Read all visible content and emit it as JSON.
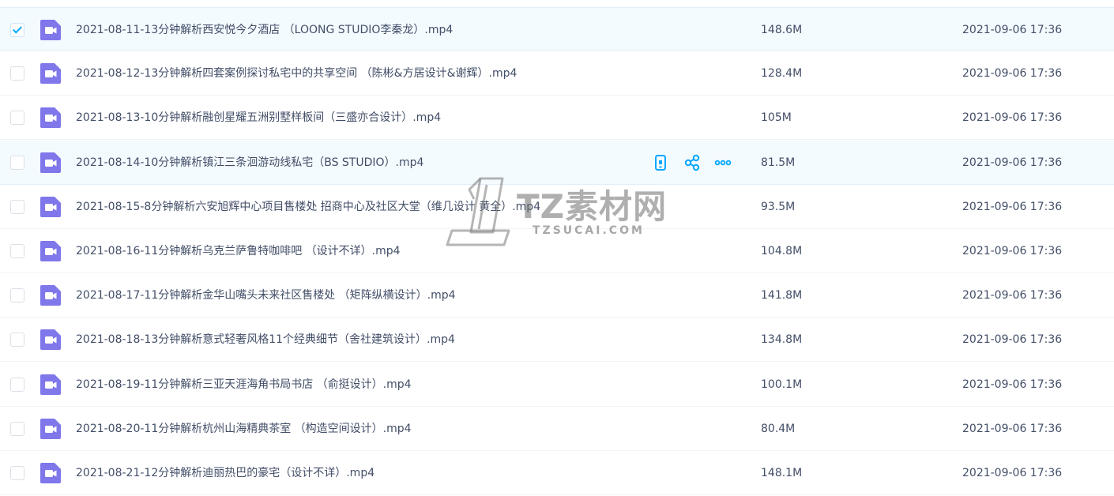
{
  "files": [
    {
      "name": "2021-08-11-13分钟解析西安悦今夕酒店 （LOONG STUDIO李秦龙）.mp4",
      "size": "148.6M",
      "date": "2021-09-06 17:36",
      "checked": true,
      "highlighted": true
    },
    {
      "name": "2021-08-12-13分钟解析四套案例探讨私宅中的共享空间 （陈彬&方居设计&谢辉）.mp4",
      "size": "128.4M",
      "date": "2021-09-06 17:36",
      "checked": false,
      "highlighted": false
    },
    {
      "name": "2021-08-13-10分钟解析融创星耀五洲别墅样板间（三盛亦合设计）.mp4",
      "size": "105M",
      "date": "2021-09-06 17:36",
      "checked": false,
      "highlighted": false
    },
    {
      "name": "2021-08-14-10分钟解析镇江三条洄游动线私宅（BS STUDIO）.mp4",
      "size": "81.5M",
      "date": "2021-09-06 17:36",
      "checked": false,
      "highlighted": true,
      "hovered": true
    },
    {
      "name": "2021-08-15-8分钟解析六安旭辉中心项目售楼处 招商中心及社区大堂（维几设计 黄全）.mp4",
      "size": "93.5M",
      "date": "2021-09-06 17:36",
      "checked": false,
      "highlighted": false
    },
    {
      "name": "2021-08-16-11分钟解析乌克兰萨鲁特咖啡吧 （设计不详）.mp4",
      "size": "104.8M",
      "date": "2021-09-06 17:36",
      "checked": false,
      "highlighted": false
    },
    {
      "name": "2021-08-17-11分钟解析金华山嘴头未来社区售楼处 （矩阵纵横设计）.mp4",
      "size": "141.8M",
      "date": "2021-09-06 17:36",
      "checked": false,
      "highlighted": false
    },
    {
      "name": "2021-08-18-13分钟解析意式轻奢风格11个经典细节（舍社建筑设计）.mp4",
      "size": "134.8M",
      "date": "2021-09-06 17:36",
      "checked": false,
      "highlighted": false
    },
    {
      "name": "2021-08-19-11分钟解析三亚天涯海角书局书店 （俞挺设计）.mp4",
      "size": "100.1M",
      "date": "2021-09-06 17:36",
      "checked": false,
      "highlighted": false
    },
    {
      "name": "2021-08-20-11分钟解析杭州山海精典茶室 （构造空间设计）.mp4",
      "size": "80.4M",
      "date": "2021-09-06 17:36",
      "checked": false,
      "highlighted": false
    },
    {
      "name": "2021-08-21-12分钟解析迪丽热巴的豪宅（设计不详）.mp4",
      "size": "148.1M",
      "date": "2021-09-06 17:36",
      "checked": false,
      "highlighted": false
    }
  ],
  "row_actions": {
    "icons": [
      "phone-icon",
      "share-icon",
      "more-icon"
    ]
  },
  "watermark": {
    "brand": "TZ素材网",
    "domain": "TZSUCAI.COM"
  },
  "colors": {
    "accent": "#06a7ff",
    "file_icon": "#7f77ea",
    "row_highlight": "#f4fbff",
    "text": "#424e67"
  }
}
